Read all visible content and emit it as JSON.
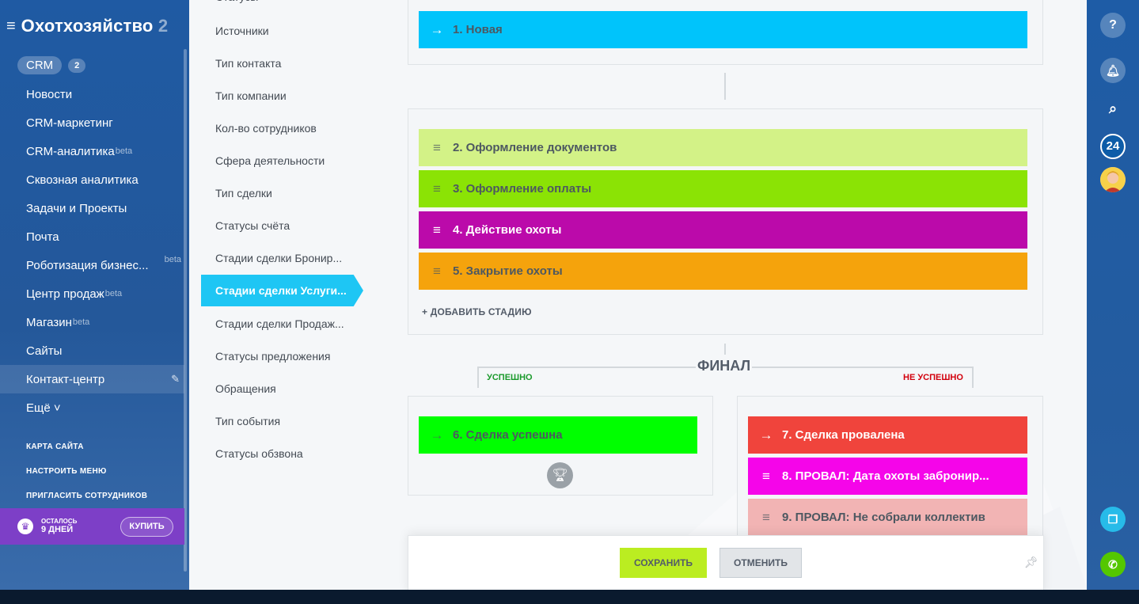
{
  "brand": {
    "title": "Охотхозяйство",
    "title_fade": " 2"
  },
  "crm": {
    "label": "CRM",
    "count": "2"
  },
  "menu": [
    {
      "label": "Новости",
      "sup": ""
    },
    {
      "label": "CRM-маркетинг",
      "sup": ""
    },
    {
      "label": "CRM-аналитика",
      "sup": "beta"
    },
    {
      "label": "Сквозная аналитика",
      "sup": ""
    },
    {
      "label": "Задачи и Проекты",
      "sup": ""
    },
    {
      "label": "Почта",
      "sup": ""
    },
    {
      "label": "Роботизация бизнес...",
      "sup": "beta"
    },
    {
      "label": "Центр продаж",
      "sup": "beta"
    },
    {
      "label": "Магазин",
      "sup": "beta"
    },
    {
      "label": "Сайты",
      "sup": ""
    },
    {
      "label": "Контакт-центр",
      "sup": ""
    },
    {
      "label": "Ещё ˅",
      "sup": ""
    }
  ],
  "menu_small": [
    "КАРТА САЙТА",
    "НАСТРОИТЬ МЕНЮ",
    "ПРИГЛАСИТЬ СОТРУДНИКОВ"
  ],
  "trial": {
    "line1": "ОСТАЛОСЬ",
    "line2": "9 ДНЕЙ",
    "buy": "КУПИТЬ"
  },
  "nav": [
    "Статусы",
    "Источники",
    "Тип контакта",
    "Тип компании",
    "Кол-во сотрудников",
    "Сфера деятельности",
    "Тип сделки",
    "Статусы счёта",
    "Стадии сделки Бронир...",
    "Стадии сделки Услуги...",
    "Стадии сделки Продаж...",
    "Статусы предложения",
    "Обращения",
    "Тип события",
    "Статусы обзвона"
  ],
  "stages": {
    "first": {
      "label": "1. Новая",
      "color": "#00c4fb"
    },
    "process": [
      {
        "label": "2. Оформление документов",
        "color": "#d3f287"
      },
      {
        "label": "3. Оформление оплаты",
        "color": "#8be305"
      },
      {
        "label": "4. Действие охоты",
        "color": "#bb0aaa"
      },
      {
        "label": "5. Закрытие охоты",
        "color": "#f5a30c"
      }
    ],
    "add_stage": "+ ДОБАВИТЬ СТАДИЮ",
    "final_title": "ФИНАЛ",
    "success_label": "УСПЕШНО",
    "fail_label": "НЕ УСПЕШНО",
    "success": {
      "label": "6. Сделка успешна",
      "color": "#00ff00"
    },
    "fail": [
      {
        "label": "7. Сделка провалена",
        "color": "#f0443c"
      },
      {
        "label": "8. ПРОВАЛ: Дата охоты забронир...",
        "color": "#f505e9"
      },
      {
        "label": "9. ПРОВАЛ: Не собрали коллектив",
        "color": "#f2b4b4"
      }
    ]
  },
  "footer": {
    "save": "СОХРАНИТЬ",
    "cancel": "ОТМЕНИТЬ"
  },
  "right_bar": {
    "bitrix_badge": "24"
  },
  "icons": {
    "help": "help-icon",
    "bell": "bell-icon",
    "search": "search-icon",
    "avatar": "avatar-icon",
    "doc": "document-icon",
    "phone": "phone-icon"
  }
}
